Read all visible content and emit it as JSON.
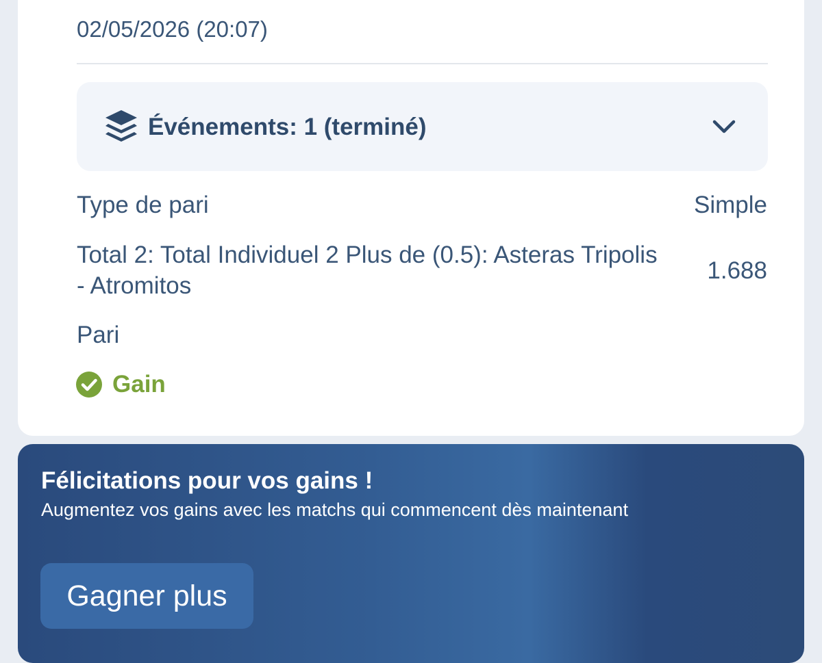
{
  "bet": {
    "date": "02/05/2026 (20:07)",
    "events_label": "Événements: 1 (terminé)",
    "type_label": "Type de pari",
    "type_value": "Simple",
    "selection": "Total 2: Total Individuel 2 Plus de (0.5): Asteras Tripolis - Atromitos",
    "odds": "1.688",
    "bet_label": "Pari",
    "result_label": "Gain",
    "result_color": "#7aa33a"
  },
  "promo": {
    "title": "Félicitations pour vos gains !",
    "subtitle": "Augmentez vos gains avec les matchs qui commencent dès maintenant",
    "button_label": "Gagner plus"
  },
  "icons": {
    "events": "layers-icon",
    "toggle": "chevron-down-icon",
    "result": "check-circle-icon"
  }
}
